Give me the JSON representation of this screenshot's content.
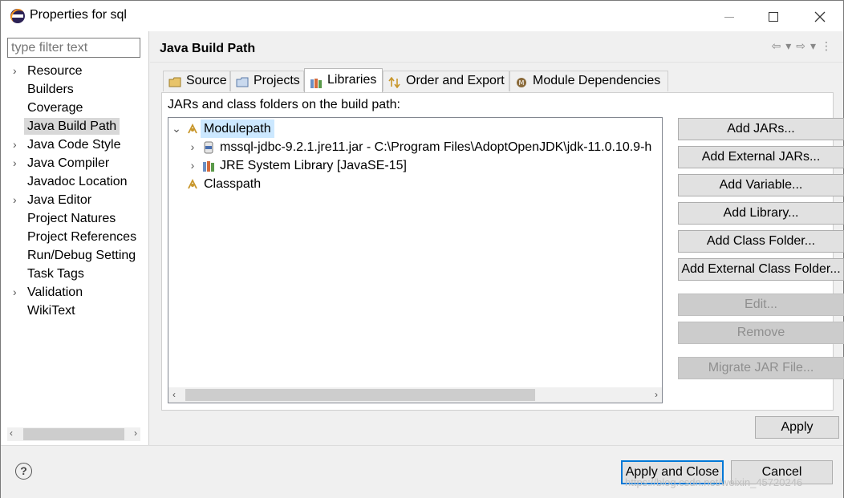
{
  "window": {
    "title": "Properties for sql"
  },
  "filter": {
    "placeholder": "type filter text"
  },
  "nav": {
    "items": [
      {
        "label": "Resource",
        "expandable": true
      },
      {
        "label": "Builders",
        "expandable": false
      },
      {
        "label": "Coverage",
        "expandable": false
      },
      {
        "label": "Java Build Path",
        "expandable": false,
        "selected": true
      },
      {
        "label": "Java Code Style",
        "expandable": true
      },
      {
        "label": "Java Compiler",
        "expandable": true
      },
      {
        "label": "Javadoc Location",
        "expandable": false
      },
      {
        "label": "Java Editor",
        "expandable": true
      },
      {
        "label": "Project Natures",
        "expandable": false
      },
      {
        "label": "Project References",
        "expandable": false
      },
      {
        "label": "Run/Debug Setting",
        "expandable": false
      },
      {
        "label": "Task Tags",
        "expandable": false
      },
      {
        "label": "Validation",
        "expandable": true
      },
      {
        "label": "WikiText",
        "expandable": false
      }
    ]
  },
  "page": {
    "title": "Java Build Path"
  },
  "tabs": [
    {
      "label": "Source",
      "icon": "source-folder-icon"
    },
    {
      "label": "Projects",
      "icon": "projects-icon"
    },
    {
      "label": "Libraries",
      "icon": "libraries-icon",
      "active": true
    },
    {
      "label": "Order and Export",
      "icon": "order-export-icon"
    },
    {
      "label": "Module Dependencies",
      "icon": "module-icon"
    }
  ],
  "libraries": {
    "label": "JARs and class folders on the build path:",
    "tree": {
      "modulepath": "Modulepath",
      "jar": "mssql-jdbc-9.2.1.jre11.jar - C:\\Program Files\\AdoptOpenJDK\\jdk-11.0.10.9-h",
      "jre": "JRE System Library [JavaSE-15]",
      "classpath": "Classpath"
    }
  },
  "buttons": {
    "add_jars": "Add JARs...",
    "add_external_jars": "Add External JARs...",
    "add_variable": "Add Variable...",
    "add_library": "Add Library...",
    "add_class_folder": "Add Class Folder...",
    "add_external_class_folder": "Add External Class Folder...",
    "edit": "Edit...",
    "remove": "Remove",
    "migrate_jar": "Migrate JAR File...",
    "apply": "Apply",
    "apply_and_close": "Apply and Close",
    "cancel": "Cancel"
  },
  "help": {
    "glyph": "?"
  },
  "watermark": "https://blog.csdn.net/weixin_45720246",
  "colors": {
    "selection": "#cce8ff",
    "default_button_border": "#0078d7",
    "eclipse_orange": "#f7941e"
  }
}
